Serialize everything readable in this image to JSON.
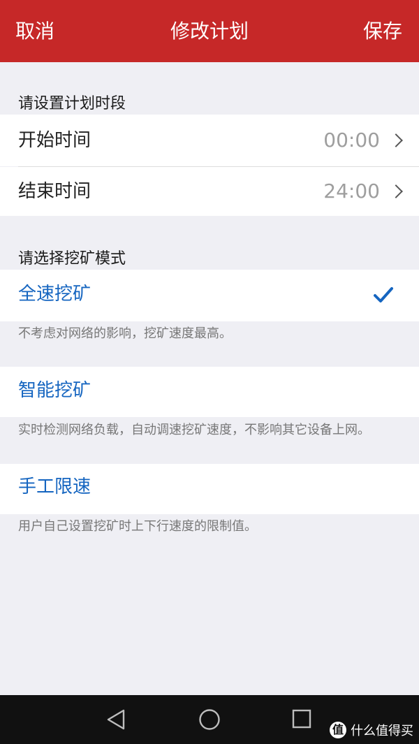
{
  "header": {
    "cancel_label": "取消",
    "title": "修改计划",
    "save_label": "保存",
    "background": "#C62828"
  },
  "time_section": {
    "title": "请设置计划时段",
    "rows": [
      {
        "label": "开始时间",
        "value": "00:00",
        "icon": "chevron-right-icon"
      },
      {
        "label": "结束时间",
        "value": "24:00",
        "icon": "chevron-right-icon"
      }
    ]
  },
  "mode_section": {
    "title": "请选择挖矿模式",
    "accent": "#1565C0",
    "options": [
      {
        "label": "全速挖矿",
        "description": "不考虑对网络的影响，挖矿速度最高。",
        "selected": true,
        "icon": "checkmark-icon"
      },
      {
        "label": "智能挖矿",
        "description": "实时检测网络负载，自动调速挖矿速度，不影响其它设备上网。",
        "selected": false
      },
      {
        "label": "手工限速",
        "description": "用户自己设置挖矿时上下行速度的限制值。",
        "selected": false
      }
    ]
  },
  "navbar": {
    "icons": [
      "back-triangle-icon",
      "home-circle-icon",
      "recent-apps-square-icon"
    ]
  },
  "watermark": {
    "logo_text": "值",
    "text": "什么值得买"
  }
}
